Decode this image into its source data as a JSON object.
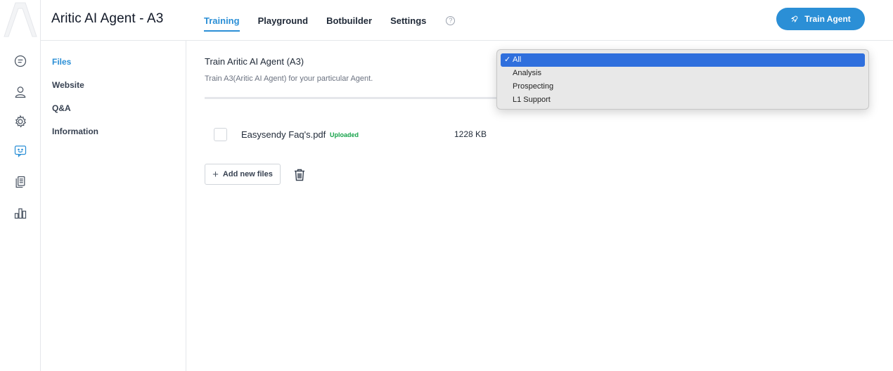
{
  "header": {
    "app_title": "Aritic AI Agent - A3",
    "tabs": [
      {
        "label": "Training"
      },
      {
        "label": "Playground"
      },
      {
        "label": "Botbuilder"
      },
      {
        "label": "Settings"
      }
    ],
    "help_glyph": "?",
    "train_button_label": "Train Agent",
    "accent_color": "#2b8fd6"
  },
  "rail": {
    "icons": [
      "chat-bubble-icon",
      "user-icon",
      "gear-icon",
      "agent-chat-icon",
      "documents-icon",
      "bar-chart-icon"
    ]
  },
  "subnav": {
    "items": [
      {
        "label": "Files"
      },
      {
        "label": "Website"
      },
      {
        "label": "Q&A"
      },
      {
        "label": "Information"
      }
    ]
  },
  "main": {
    "title": "Train Aritic AI Agent (A3)",
    "description": "Train A3(Aritic AI Agent) for your particular Agent.",
    "files": [
      {
        "name": "Easysendy Faq's.pdf",
        "status": "Uploaded",
        "size": "1228 KB"
      }
    ],
    "add_button_label": "Add new files",
    "status_color": "#16a34a"
  },
  "dropdown": {
    "options": [
      {
        "label": "All",
        "selected": true
      },
      {
        "label": "Analysis",
        "selected": false
      },
      {
        "label": "Prospecting",
        "selected": false
      },
      {
        "label": "L1 Support",
        "selected": false
      }
    ],
    "check_glyph": "✓",
    "highlight_color": "#2f6fdd"
  }
}
